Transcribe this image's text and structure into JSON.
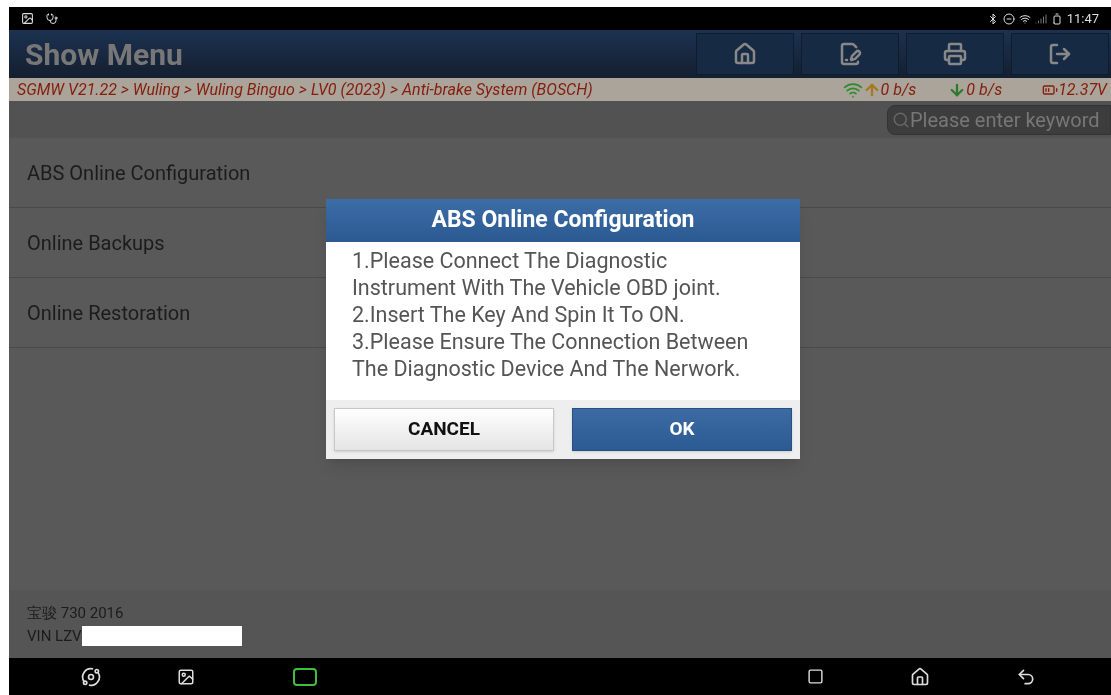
{
  "status_bar": {
    "time": "11:47"
  },
  "header": {
    "title": "Show Menu"
  },
  "breadcrumb": {
    "path": "SGMW V21.22 > Wuling > Wuling Binguo > LV0 (2023) > Anti-brake System (BOSCH)",
    "upload": "0 b/s",
    "download": "0 b/s",
    "voltage": "12.37V"
  },
  "search": {
    "placeholder": "Please enter keyword"
  },
  "menu_items": [
    {
      "label": "ABS Online Configuration"
    },
    {
      "label": "Online Backups"
    },
    {
      "label": "Online Restoration"
    }
  ],
  "dialog": {
    "title": "ABS Online Configuration",
    "message": "1.Please Connect The Diagnostic Instrument With The Vehicle OBD joint.\n2.Insert The Key And Spin It To ON.\n3.Please Ensure The Connection Between The Diagnostic Device And The Nerwork.",
    "buttons": [
      {
        "label": "CANCEL",
        "kind": "secondary"
      },
      {
        "label": "OK",
        "kind": "primary"
      }
    ]
  },
  "footer": {
    "vehicle": "宝骏 730 2016",
    "vin": "VIN LZV"
  }
}
